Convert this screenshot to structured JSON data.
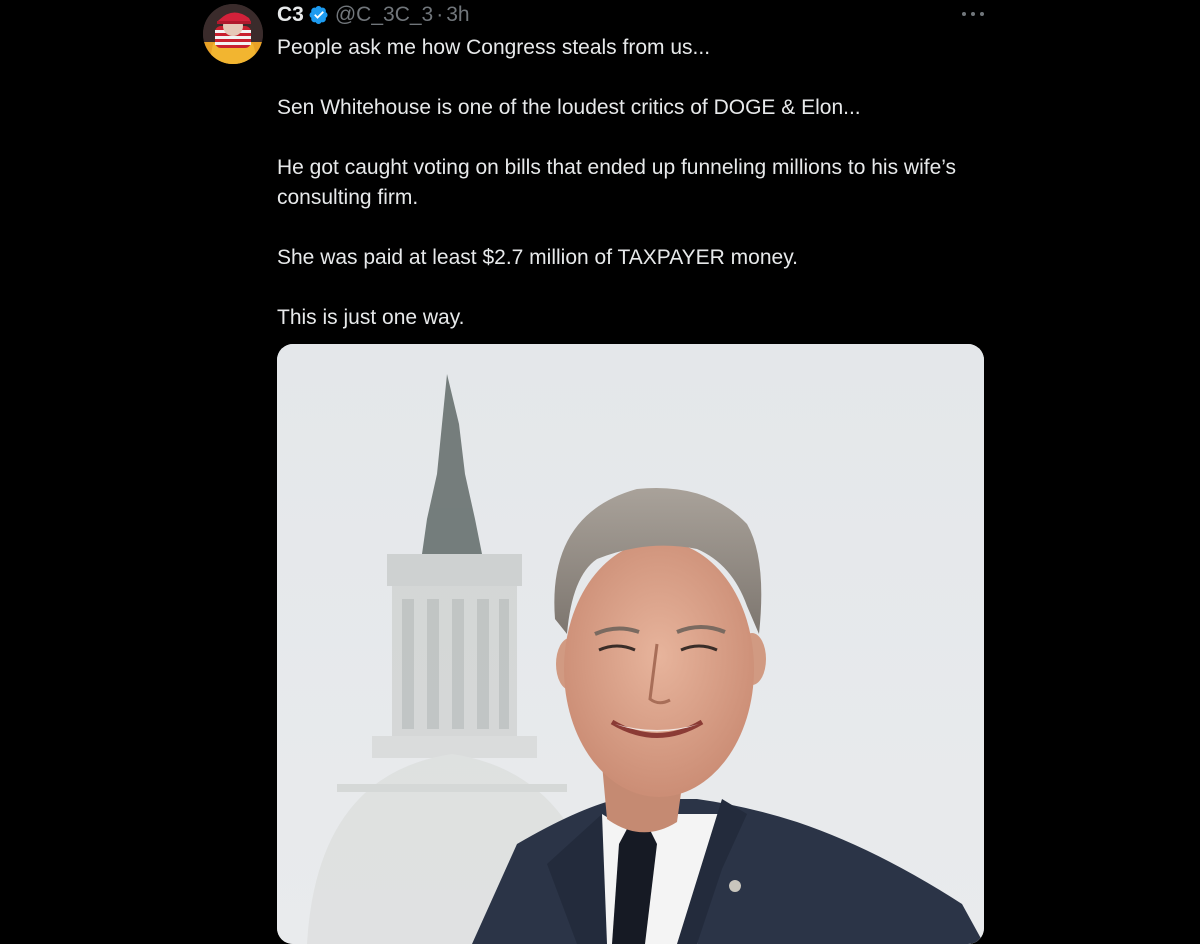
{
  "author": {
    "display_name": "C3",
    "handle": "@C_3C_3",
    "separator": "·",
    "time": "3h",
    "verified": true,
    "avatar_icon": "profile-avatar-icon"
  },
  "menu": {
    "icon": "more-options-icon"
  },
  "post": {
    "paragraphs": [
      "People ask me how Congress steals from us...",
      "Sen Whitehouse is one of the loudest critics of DOGE & Elon...",
      "He got caught voting on bills that ended up funneling millions to his wife’s consulting firm.",
      "She was paid at least $2.7 million of TAXPAYER money.",
      "This is just one way."
    ]
  },
  "media": {
    "type": "photo"
  },
  "colors": {
    "background": "#000000",
    "text_primary": "#e7e9ea",
    "text_secondary": "#71767b",
    "verified_blue": "#1d9bf0"
  }
}
